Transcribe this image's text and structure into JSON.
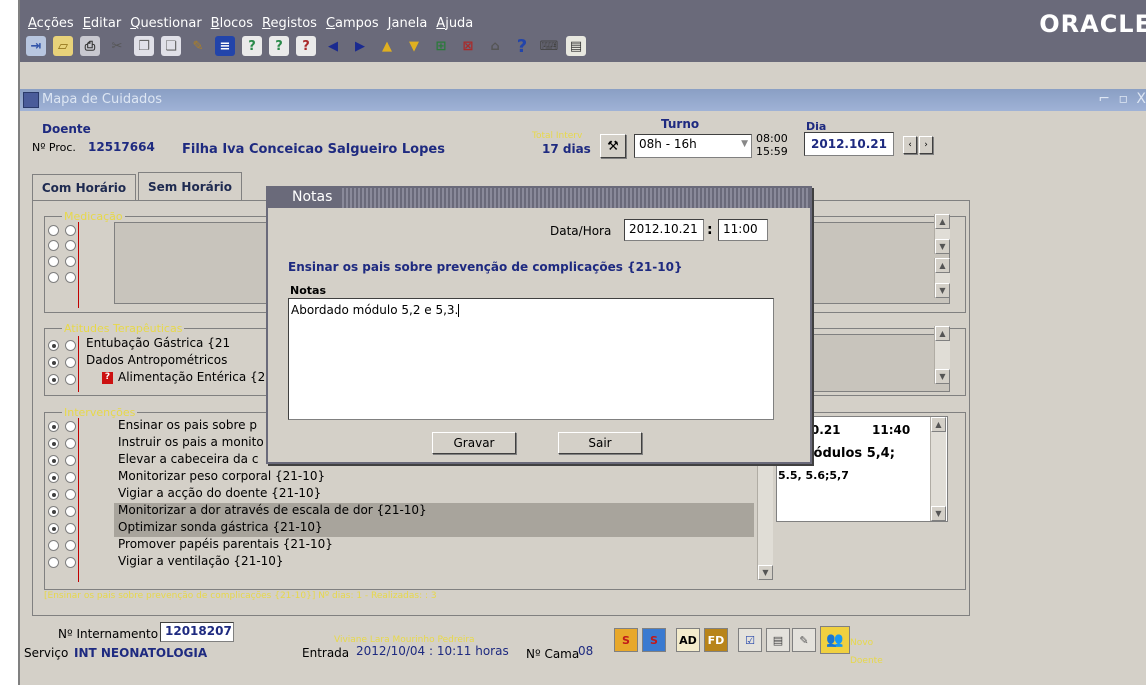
{
  "menu": [
    "Acções",
    "Editar",
    "Questionar",
    "Blocos",
    "Registos",
    "Campos",
    "Janela",
    "Ajuda"
  ],
  "brand": "ORACLE",
  "toolbar_icons": [
    "exit-icon",
    "open-icon",
    "print-icon",
    "cut-icon",
    "copy-icon",
    "paste-icon",
    "edit-icon",
    "list-icon",
    "enter-query-icon",
    "execute-query-icon",
    "cancel-query-icon",
    "prev-block-icon",
    "next-block-icon",
    "prev-record-icon",
    "next-record-icon",
    "insert-record-icon",
    "delete-record-icon",
    "save-icon",
    "help-icon",
    "show-keys-icon",
    "notes-icon"
  ],
  "window": {
    "title": "Mapa de Cuidados",
    "controls": "⌐ ▫ X"
  },
  "header": {
    "doente_label": "Doente",
    "nproc_label": "Nº Proc.",
    "nproc_value": "12517664",
    "patient_name": "Filha Iva Conceicao Salgueiro Lopes",
    "total_label": "Total Interv",
    "total_days": "17 dias",
    "turno_label": "Turno",
    "turno_value": "08h - 16h",
    "turno_start": "08:00",
    "turno_end": "15:59",
    "dia_label": "Dia",
    "dia_value": "2012.10.21"
  },
  "tabs": [
    "Com Horário",
    "Sem Horário"
  ],
  "groups": {
    "medicacao": "Medicação",
    "atitudes": "Atitudes Terapêuticas",
    "intervencoes": "Intervenções"
  },
  "atitudes_rows": [
    "Entubação Gástrica {21",
    "Dados Antropométricos",
    "Alimentação Entérica {2"
  ],
  "intervencoes_rows": [
    "Ensinar os pais sobre p",
    "Instruir os pais a monito",
    "Elevar a cabeceira da c",
    "Monitorizar peso corporal {21-10}",
    "Vigiar a acção do doente {21-10}",
    "Monitorizar a dor através de escala de dor {21-10}",
    "Optimizar sonda gástrica {21-10}",
    "Promover papéis parentais {21-10}",
    "Vigiar a ventilação {21-10}"
  ],
  "detail": {
    "date": ".10.21",
    "time": "11:40",
    "line1": "módulos 5,4;",
    "line2": "5.5, 5.6;5,7"
  },
  "status_line": "[Ensinar os pais sobre prevenção de complicações {21-10}] Nº dias: 1 - Realizadas: : 3",
  "footer": {
    "internamento_label": "Nº Internamento",
    "internamento_value": "12018207",
    "servico_label": "Serviço",
    "servico_value": "INT NEONATOLOGIA",
    "nurse_name": "Viviane Lara Mourinho Pedreira",
    "entrada_label": "Entrada",
    "entrada_value": "2012/10/04 : 10:11 horas",
    "cama_label": "Nº Cama",
    "cama_value": "08",
    "btn_ad": "AD",
    "btn_fd": "FD",
    "novo_doente_1": "Novo",
    "novo_doente_2": "Doente"
  },
  "dialog": {
    "title": "Notas",
    "datahora_label": "Data/Hora",
    "date_value": "2012.10.21",
    "colon": ":",
    "time_value": "11:00",
    "intervention": "Ensinar os pais sobre prevenção de complicações {21-10}",
    "notas_label": "Notas",
    "notas_text": "Abordado módulo 5,2 e 5,3.",
    "save_label": "Gravar",
    "exit_label": "Sair"
  }
}
